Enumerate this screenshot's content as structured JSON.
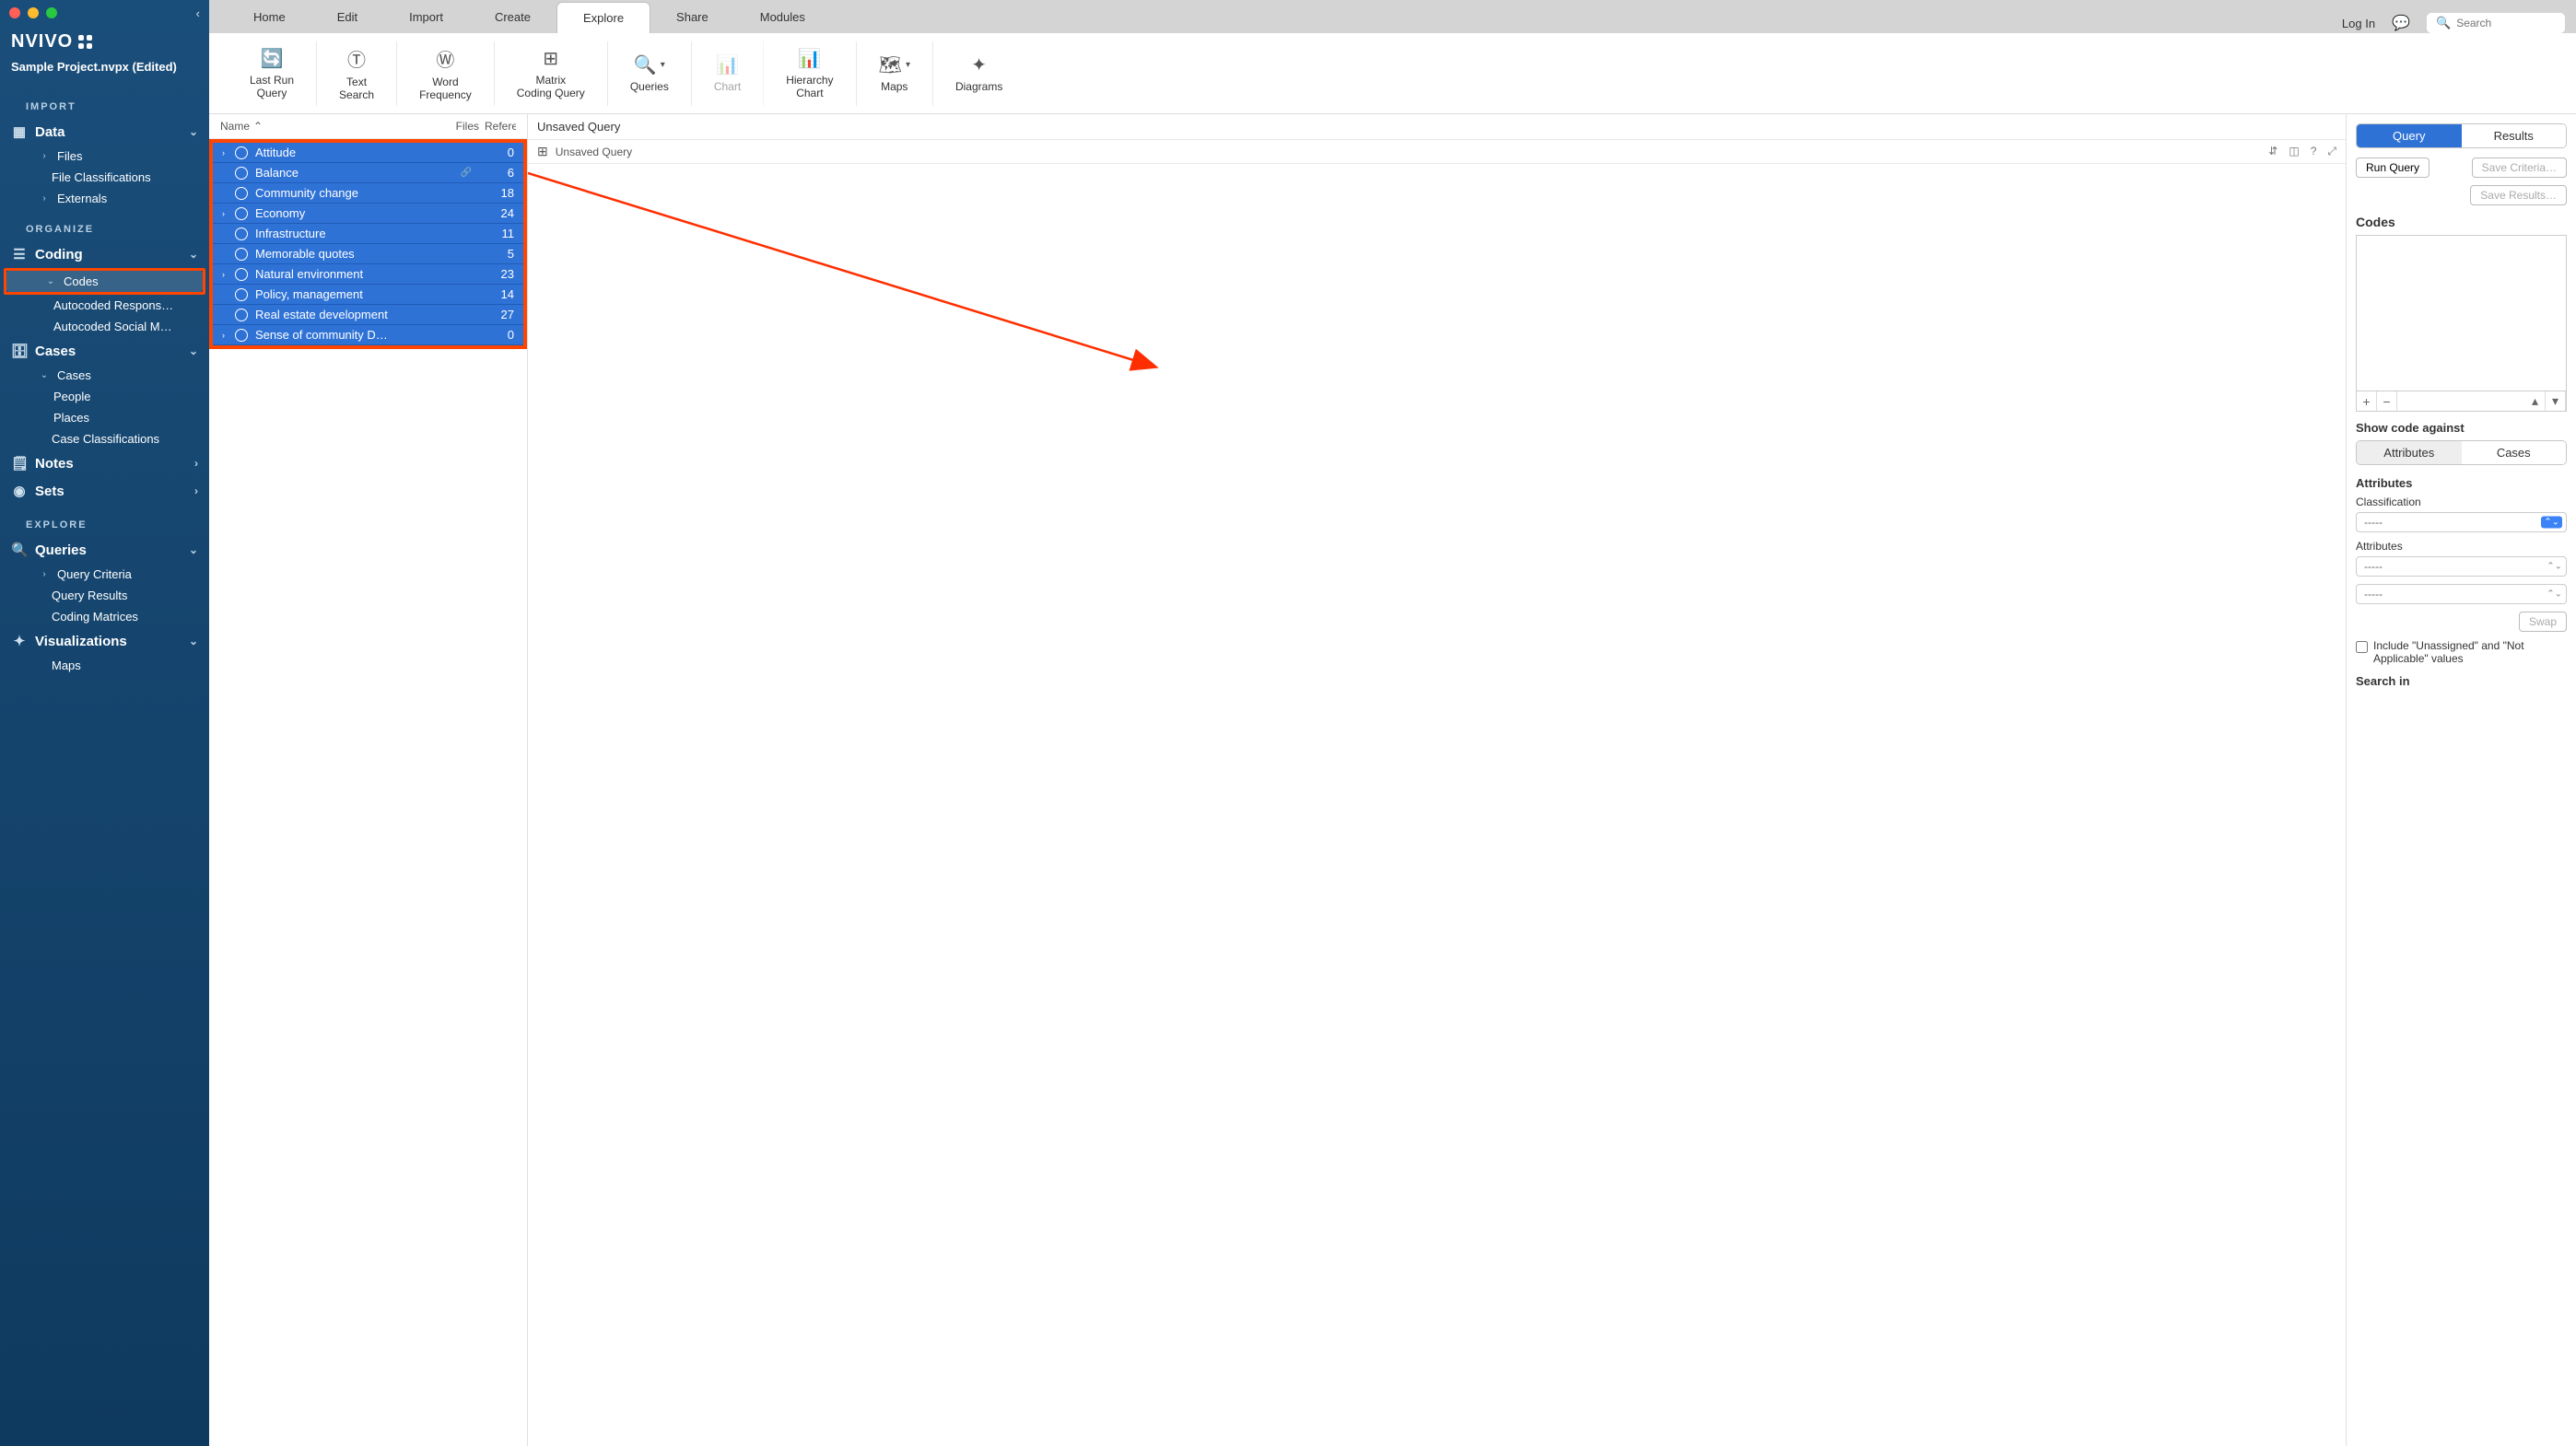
{
  "window": {
    "collapse_glyph": "‹"
  },
  "brand": "NVIVO",
  "project_name": "Sample Project.nvpx (Edited)",
  "sidebar": {
    "sections": {
      "import": "IMPORT",
      "organize": "ORGANIZE",
      "explore": "EXPLORE"
    },
    "data": {
      "label": "Data",
      "files": "Files",
      "file_class": "File Classifications",
      "externals": "Externals"
    },
    "coding": {
      "label": "Coding",
      "codes": "Codes",
      "auto_resp": "Autocoded Respons…",
      "auto_social": "Autocoded Social M…"
    },
    "cases": {
      "label": "Cases",
      "cases_item": "Cases",
      "people": "People",
      "places": "Places",
      "case_class": "Case Classifications"
    },
    "notes": "Notes",
    "sets": "Sets",
    "queries": {
      "label": "Queries",
      "criteria": "Query Criteria",
      "results": "Query Results",
      "matrices": "Coding Matrices"
    },
    "visualizations": {
      "label": "Visualizations",
      "maps": "Maps"
    }
  },
  "tabs": [
    "Home",
    "Edit",
    "Import",
    "Create",
    "Explore",
    "Share",
    "Modules"
  ],
  "tabbar_right": {
    "login": "Log In",
    "search_placeholder": "Search"
  },
  "ribbon": [
    {
      "label": "Last Run\nQuery"
    },
    {
      "label": "Text\nSearch"
    },
    {
      "label": "Word\nFrequency"
    },
    {
      "label": "Matrix\nCoding Query"
    },
    {
      "label": "Queries",
      "dropdown": true
    },
    {
      "label": "Chart",
      "disabled": true
    },
    {
      "label": "Hierarchy\nChart"
    },
    {
      "label": "Maps",
      "dropdown": true
    },
    {
      "label": "Diagrams"
    }
  ],
  "code_columns": {
    "name": "Name",
    "files": "Files",
    "ref": "Referen"
  },
  "codes": [
    {
      "name": "Attitude",
      "files": 0,
      "expandable": true
    },
    {
      "name": "Balance",
      "files": 6,
      "link": true
    },
    {
      "name": "Community change",
      "files": 18
    },
    {
      "name": "Economy",
      "files": 24,
      "expandable": true
    },
    {
      "name": "Infrastructure",
      "files": 11
    },
    {
      "name": "Memorable quotes",
      "files": 5
    },
    {
      "name": "Natural environment",
      "files": 23,
      "expandable": true
    },
    {
      "name": "Policy, management",
      "files": 14
    },
    {
      "name": "Real estate development",
      "files": 27
    },
    {
      "name": "Sense of community D…",
      "files": 0,
      "expandable": true
    }
  ],
  "detail": {
    "title": "Unsaved Query",
    "tab_label": "Unsaved Query"
  },
  "props": {
    "seg_query": "Query",
    "seg_results": "Results",
    "run_query": "Run Query",
    "save_criteria": "Save Criteria…",
    "save_results": "Save Results…",
    "codes_heading": "Codes",
    "show_against": "Show code against",
    "seg_attr": "Attributes",
    "seg_cases": "Cases",
    "attributes_heading": "Attributes",
    "classification_label": "Classification",
    "attributes_label": "Attributes",
    "placeholder_dash": "-----",
    "swap": "Swap",
    "include_unassigned": "Include \"Unassigned\" and \"Not Applicable\" values",
    "search_in": "Search in"
  }
}
